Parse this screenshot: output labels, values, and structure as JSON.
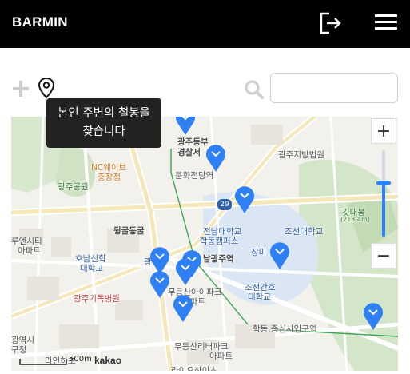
{
  "header": {
    "brand": "BARMIN",
    "logout_icon": "logout-icon",
    "menu_icon": "hamburger-menu-icon"
  },
  "toolbar": {
    "add_icon": "plus-icon",
    "locate_icon": "map-pin-icon",
    "search_icon": "search-icon",
    "search_value": "",
    "tooltip_line1": "본인 주변의 철봉을",
    "tooltip_line2": "찾습니다"
  },
  "map": {
    "labels": {
      "gwangju_dongbu": "광주동부",
      "police": "경찰서",
      "court": "광주지방법원",
      "nc_wave": "NC웨이브",
      "chungjang": "충장점",
      "culture_station": "문화전당역",
      "gwangju_park": "광주공원",
      "river_bridge": "뒹굴동굴",
      "cnu": "전남대학교",
      "hakdong_campus": "학동캠퍼스",
      "num_29": "29",
      "chosun_univ": "조선대학교",
      "jangmi": "장미",
      "gitdaebong": "깃대봉",
      "peak_height": "(213.4m)",
      "royal_apt": "루엔시티",
      "apt": "아파트",
      "honam": "호남신학",
      "honam2": "대학교",
      "namgwangju": "남광주역",
      "gwang_dae": "광주",
      "chosun_nurse": "조선간호",
      "chosun_nurse2": "대학교",
      "mudeung": "무등산아이파크",
      "mudeung2": "아파트",
      "christian_hosp": "광주기독병원",
      "hakdong_station": "학동.증심사입구역",
      "gwangyeok": "광역시",
      "gu_office": "구청",
      "mudeung_libra": "무등산리버파크",
      "mudeung_libra2": "아파트",
      "raion": "라인하초",
      "raion2": "라이오하이츠",
      "scale": "500m",
      "provider": "kakao"
    },
    "marker_color": "#2f7ff5",
    "zoom_level": 0.62
  },
  "zoom": {
    "plus": "+",
    "minus": "−"
  }
}
